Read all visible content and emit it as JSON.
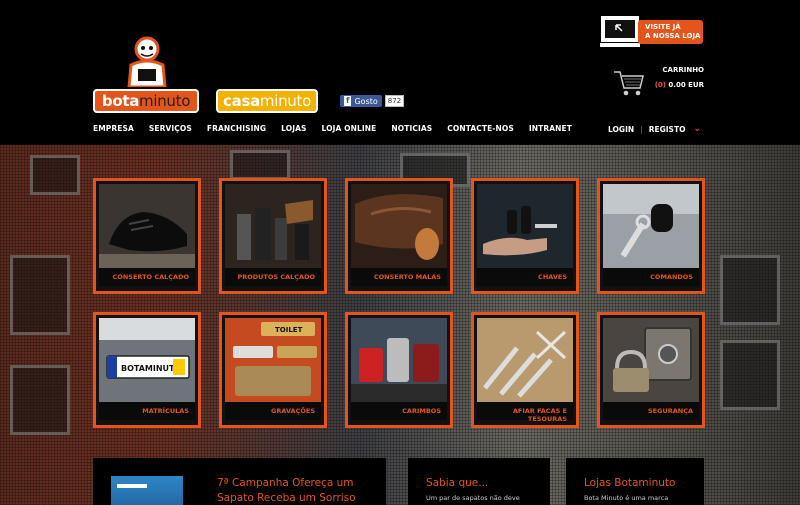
{
  "brand": {
    "bota_part1": "bota",
    "bota_part2": "minuto",
    "casa_part1": "casa",
    "casa_part2": "minuto"
  },
  "facebook": {
    "like_label": "Gosto",
    "count": "872"
  },
  "visit": {
    "line1": "VISITE JÁ",
    "line2": "A NOSSA LOJA"
  },
  "cart": {
    "title": "CARRINHO",
    "count": "(0)",
    "total": "0.00 EUR"
  },
  "nav": [
    "EMPRESA",
    "SERVIÇOS",
    "FRANCHISING",
    "LOJAS",
    "LOJA ONLINE",
    "NOTICIAS",
    "CONTACTE-NOS",
    "INTRANET"
  ],
  "account": {
    "login": "LOGIN",
    "separator": "|",
    "register": "REGISTO"
  },
  "tiles": [
    {
      "label": "CONSERTO CALÇADO",
      "icon": "shoe"
    },
    {
      "label": "PRODUTOS CALÇADO",
      "icon": "shoe-care-products"
    },
    {
      "label": "CONSERTO MALAS",
      "icon": "leather-bag"
    },
    {
      "label": "CHAVES",
      "icon": "keys"
    },
    {
      "label": "COMANDOS",
      "icon": "car-remote"
    },
    {
      "label": "MATRÍCULAS",
      "icon": "license-plate"
    },
    {
      "label": "GRAVAÇÕES",
      "icon": "engraved-plates"
    },
    {
      "label": "CARIMBOS",
      "icon": "stamps"
    },
    {
      "label": "AFIAR FACAS E TESOURAS",
      "icon": "knives-scissors"
    },
    {
      "label": "SEGURANÇA",
      "icon": "safe"
    }
  ],
  "cards": [
    {
      "title": "7ª Campanha Ofereça um Sapato Receba um Sorriso",
      "text": ""
    },
    {
      "title": "Sabia que...",
      "text": "Um par de sapatos não deve"
    },
    {
      "title": "Lojas Botaminuto",
      "text": "Bota Minuto é uma marca"
    }
  ],
  "colors": {
    "accent": "#e4551c",
    "casa": "#f3b200",
    "background": "#000000"
  }
}
